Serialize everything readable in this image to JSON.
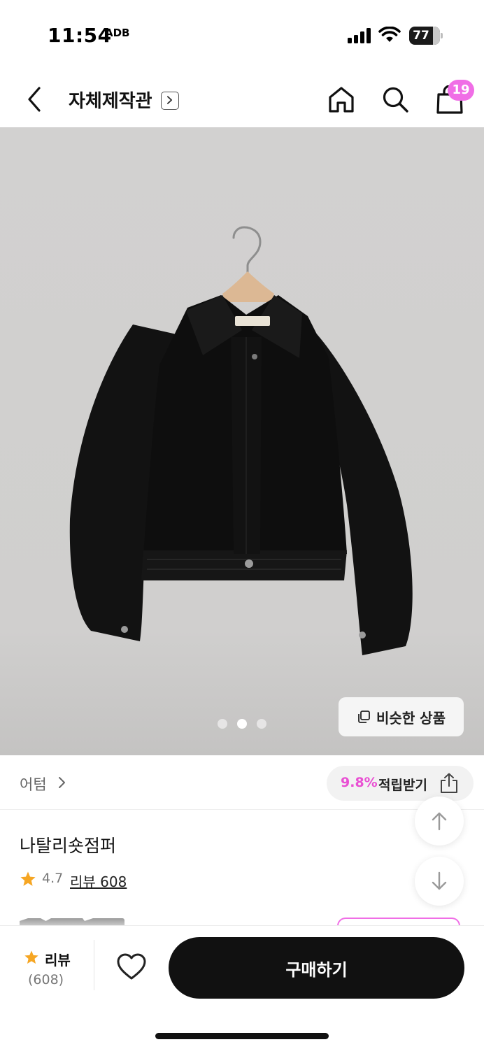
{
  "status_bar": {
    "time": "11:54",
    "extra": "ADB",
    "battery": "77"
  },
  "header": {
    "title": "자체제작관",
    "cart_count": "19"
  },
  "gallery": {
    "dots_total": 3,
    "dots_active": 2,
    "similar_button": "비슷한 상품"
  },
  "brand_row": {
    "brand_name": "어텀",
    "points_rate": "9.8%",
    "points_label": "적립받기"
  },
  "product": {
    "name": "나탈리숏점퍼",
    "rating": "4.7",
    "review_link": "리뷰 608"
  },
  "bottom_bar": {
    "review_label": "리뷰",
    "review_count": "(608)",
    "buy_label": "구매하기"
  },
  "colors": {
    "accent_pink": "#f06ee6",
    "points_pink": "#e94fd3",
    "star_orange": "#f6a623",
    "buy_button": "#111111"
  },
  "icons": [
    "back-arrow-icon",
    "chevron-right-icon",
    "home-icon",
    "search-icon",
    "shopping-bag-icon",
    "copy-icon",
    "share-icon",
    "arrow-up-icon",
    "arrow-down-icon",
    "star-icon",
    "heart-icon"
  ]
}
